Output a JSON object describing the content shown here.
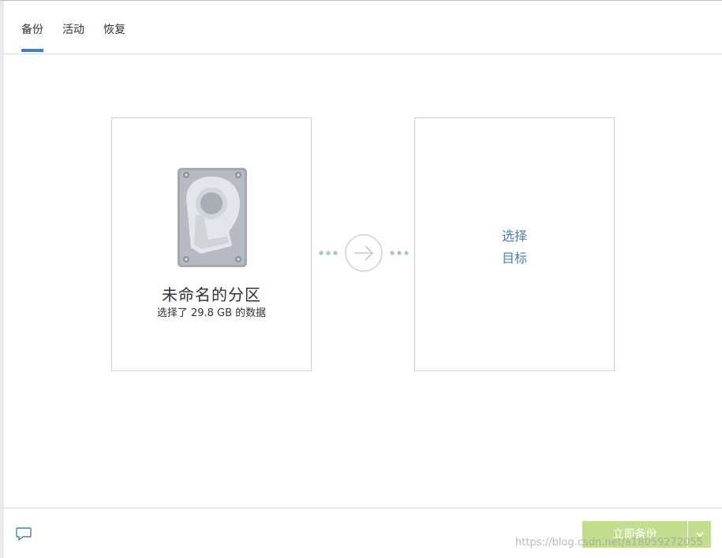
{
  "tabs": [
    {
      "label": "备份",
      "active": true
    },
    {
      "label": "活动",
      "active": false
    },
    {
      "label": "恢复",
      "active": false
    }
  ],
  "source": {
    "icon": "hard-disk-icon",
    "title": "未命名的分区",
    "subtitle": "选择了 29.8 GB 的数据"
  },
  "connector": {
    "icon": "arrow-right-icon"
  },
  "target": {
    "line1": "选择",
    "line2": "目标"
  },
  "footer": {
    "feedback_icon": "chat-bubble-icon",
    "backup_button_label": "立即备份",
    "dropdown_icon": "chevron-down-icon"
  },
  "watermark": "https://blog.csdn.net/a18059272055",
  "colors": {
    "accent": "#4a7db0",
    "card_border": "#c7d6e6",
    "button_bg": "#c2dd8c"
  }
}
